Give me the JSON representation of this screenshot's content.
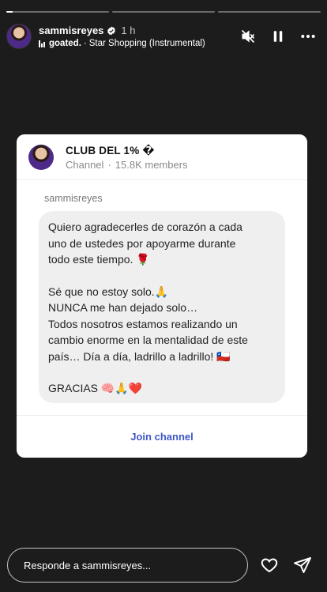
{
  "story": {
    "progress": [
      0.06,
      0,
      0
    ]
  },
  "header": {
    "username": "sammisreyes",
    "time": "1 h",
    "music_artist": "goated.",
    "music_title": "Star Shopping (Instrumental)",
    "music_sep": "·"
  },
  "card": {
    "channel_name": "CLUB DEL 1% �",
    "channel_type": "Channel",
    "channel_sep": "·",
    "members": "15.8K members",
    "sender": "sammisreyes",
    "message_lines_1": [
      "Quiero agradecerles de corazón a cada",
      "uno de ustedes por apoyarme durante",
      "todo este tiempo. 🌹"
    ],
    "message_lines_2": [
      "Sé que no estoy solo.🙏",
      "NUNCA me han dejado solo…",
      "Todos nosotros estamos realizando un",
      "cambio enorme en la mentalidad de este",
      "país… Día a día, ladrillo a ladrillo! 🇨🇱"
    ],
    "message_lines_3": [
      "GRACIAS 🧠🙏❤️"
    ],
    "join_label": "Join channel"
  },
  "reply": {
    "placeholder": "Responde a sammisreyes..."
  },
  "icons": {
    "mute": "speaker-muted-icon",
    "pause": "pause-icon",
    "more": "more-horizontal-icon",
    "like": "heart-icon",
    "send": "paper-plane-icon",
    "verified": "verified-badge-icon"
  },
  "colors": {
    "background": "#1c1c1c",
    "card": "#ffffff",
    "bubble": "#efefef",
    "link": "#3f57c7"
  }
}
